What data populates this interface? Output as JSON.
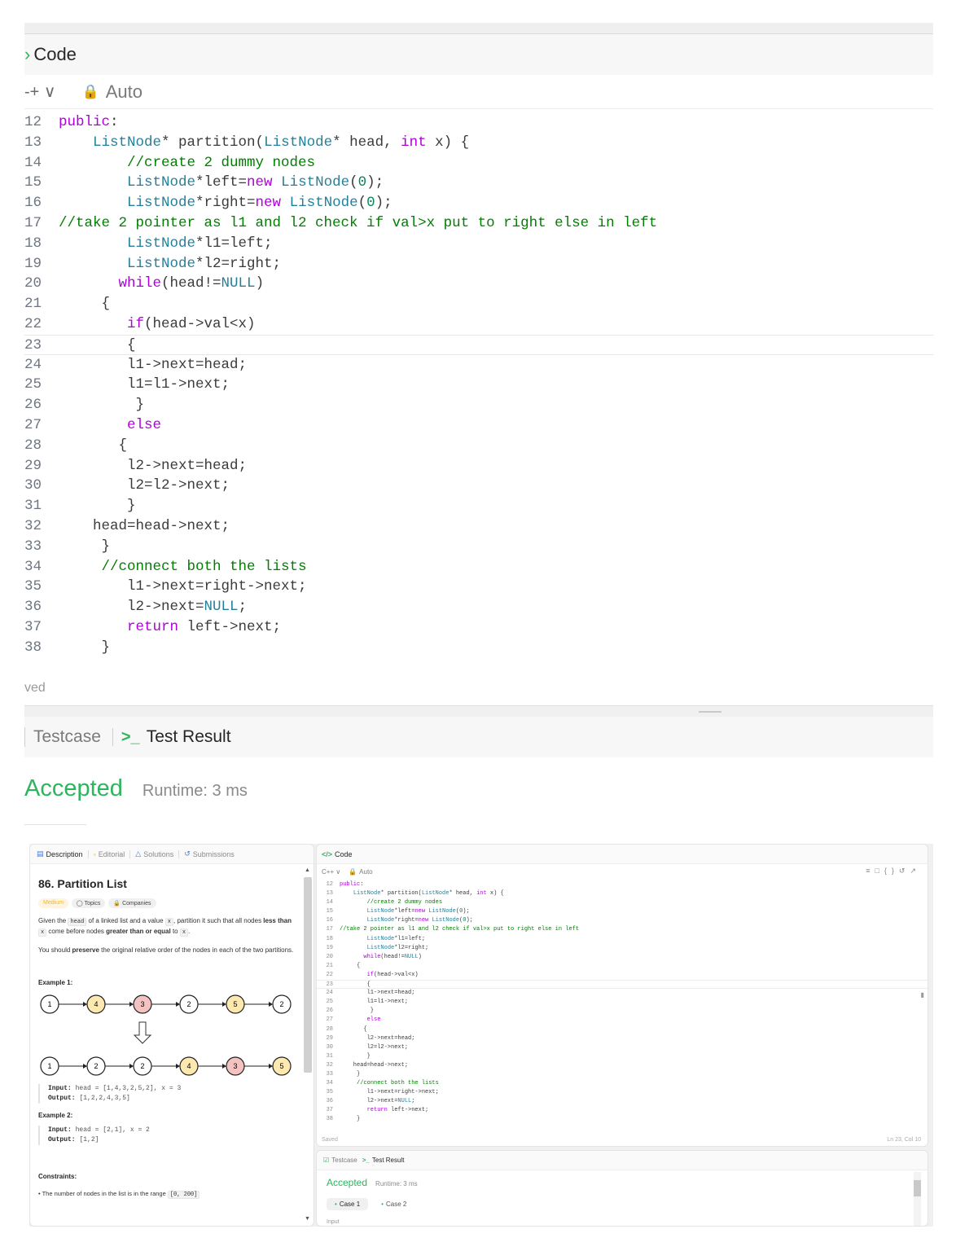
{
  "zoom": {
    "header_title": "Code",
    "language_fragment": "-+ ∨",
    "auto_label": "Auto",
    "saved_fragment": "ved",
    "tab_testcase": "Testcase",
    "tab_test_result": "Test Result",
    "result_status": "Accepted",
    "runtime": "Runtime: 3 ms"
  },
  "code_lines": [
    {
      "n": "12",
      "indent": 0,
      "text": "public:"
    },
    {
      "n": "13",
      "indent": 4,
      "text": "ListNode* partition(ListNode* head, int x) {"
    },
    {
      "n": "14",
      "indent": 8,
      "text": "//create 2 dummy nodes"
    },
    {
      "n": "15",
      "indent": 8,
      "text": "ListNode*left=new ListNode(0);"
    },
    {
      "n": "16",
      "indent": 8,
      "text": "ListNode*right=new ListNode(0);"
    },
    {
      "n": "17",
      "indent": 0,
      "text": "//take 2 pointer as l1 and l2 check if val>x put to right else in left"
    },
    {
      "n": "18",
      "indent": 8,
      "text": "ListNode*l1=left;"
    },
    {
      "n": "19",
      "indent": 8,
      "text": "ListNode*l2=right;"
    },
    {
      "n": "20",
      "indent": 7,
      "text": "while(head!=NULL)"
    },
    {
      "n": "21",
      "indent": 5,
      "text": "{"
    },
    {
      "n": "22",
      "indent": 8,
      "text": "if(head->val<x)"
    },
    {
      "n": "23",
      "indent": 8,
      "text": "{"
    },
    {
      "n": "24",
      "indent": 8,
      "text": "l1->next=head;"
    },
    {
      "n": "25",
      "indent": 8,
      "text": "l1=l1->next;"
    },
    {
      "n": "26",
      "indent": 9,
      "text": "}"
    },
    {
      "n": "27",
      "indent": 8,
      "text": "else"
    },
    {
      "n": "28",
      "indent": 7,
      "text": "{"
    },
    {
      "n": "29",
      "indent": 8,
      "text": "l2->next=head;"
    },
    {
      "n": "30",
      "indent": 8,
      "text": "l2=l2->next;"
    },
    {
      "n": "31",
      "indent": 8,
      "text": "}"
    },
    {
      "n": "32",
      "indent": 4,
      "text": "head=head->next;"
    },
    {
      "n": "33",
      "indent": 5,
      "text": "}"
    },
    {
      "n": "34",
      "indent": 5,
      "text": "//connect both the lists"
    },
    {
      "n": "35",
      "indent": 8,
      "text": "l1->next=right->next;"
    },
    {
      "n": "36",
      "indent": 8,
      "text": "l2->next=NULL;"
    },
    {
      "n": "37",
      "indent": 8,
      "text": "return left->next;"
    },
    {
      "n": "38",
      "indent": 5,
      "text": "}"
    }
  ],
  "full": {
    "left_tabs": [
      "Description",
      "Editorial",
      "Solutions",
      "Submissions"
    ],
    "problem_title": "86. Partition List",
    "chips": [
      "Medium",
      "Topics",
      "Companies"
    ],
    "desc_1a": "Given the ",
    "desc_1b": "head",
    "desc_1c": " of a linked list and a value ",
    "desc_1d": "x",
    "desc_1e": ", partition it such that all nodes ",
    "desc_1f": "less than",
    "desc_1g": " ",
    "desc_1h": "x",
    "desc_1i": " come before nodes ",
    "desc_1j": "greater than or equal",
    "desc_1k": " to ",
    "desc_1l": "x",
    "desc_1m": ".",
    "desc_2a": "You should ",
    "desc_2b": "preserve",
    "desc_2c": " the original relative order of the nodes in each of the two partitions.",
    "example1_title": "Example 1:",
    "example1_row1": [
      "1",
      "4",
      "3",
      "2",
      "5",
      "2"
    ],
    "example1_row2": [
      "1",
      "2",
      "2",
      "4",
      "3",
      "5"
    ],
    "example1_input_label": "Input:",
    "example1_input": "head = [1,4,3,2,5,2], x = 3",
    "example1_output_label": "Output:",
    "example1_output": "[1,2,2,4,3,5]",
    "example2_title": "Example 2:",
    "example2_input_label": "Input:",
    "example2_input": "head = [2,1], x = 2",
    "example2_output_label": "Output:",
    "example2_output": "[1,2]",
    "constraints_title": "Constraints:",
    "constraint_1": "The number of nodes in the list is in the range ",
    "constraint_1_code": "[0, 200]",
    "code_header": "Code",
    "code_lang": "C++ ∨",
    "code_auto": "Auto",
    "code_saved": "Saved",
    "code_position": "Ln 23, Col 10",
    "test_tab_testcase": "Testcase",
    "test_tab_result": "Test Result",
    "test_status": "Accepted",
    "test_runtime": "Runtime: 3 ms",
    "case1": "Case 1",
    "case2": "Case 2",
    "input_label": "Input"
  },
  "colors": {
    "accent_green": "#2db55d",
    "keyword": "#af00db",
    "type": "#267f99",
    "comment": "#008000",
    "string_new": "#c678dd",
    "node_yellow": "#fde8b0",
    "node_red": "#f5c2c2"
  }
}
